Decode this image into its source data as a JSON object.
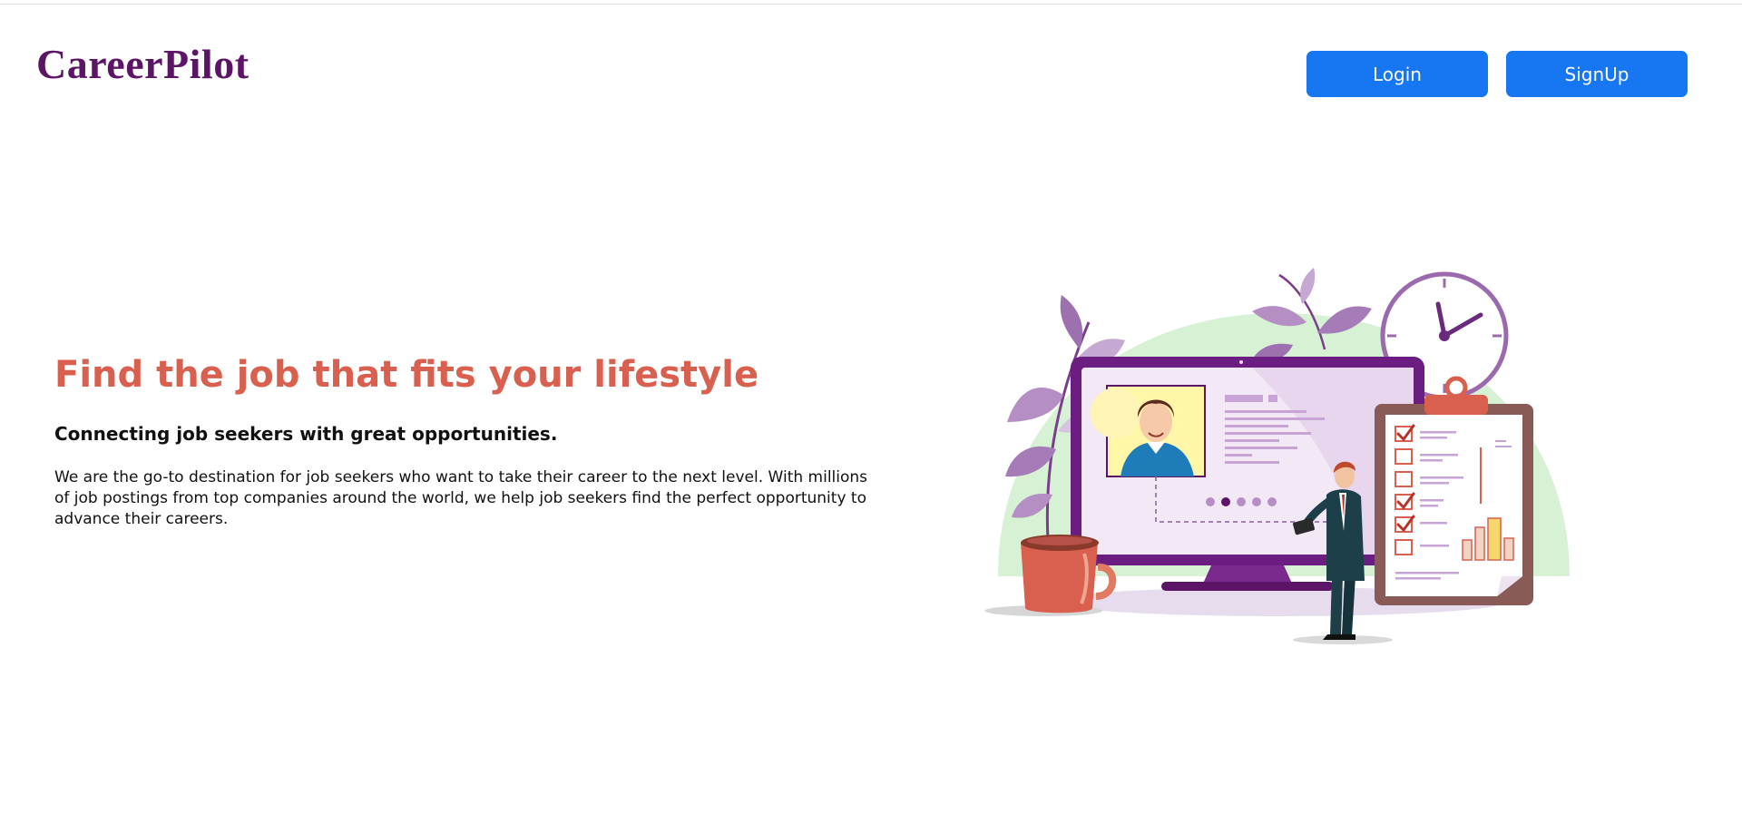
{
  "header": {
    "brand": "CareerPilot",
    "login_label": "Login",
    "signup_label": "SignUp"
  },
  "hero": {
    "title": "Find the job that fits your lifestyle",
    "subtitle": "Connecting job seekers with great opportunities.",
    "description": "We are the go-to destination for job seekers who want to take their career to the next level. With millions of job postings from top companies around the world, we help job seekers find the perfect opportunity to advance their careers."
  },
  "illustration": {
    "icon": "job-search-illustration",
    "carousel_dots": 5,
    "active_dot": 1,
    "checklist_items": 6,
    "checked_items": [
      0,
      3,
      4
    ]
  },
  "colors": {
    "brand": "#5c1466",
    "button": "#1776f2",
    "headline": "#d9604f",
    "purple_accent": "#7a2a8c",
    "green_bg": "#d7f1d4"
  }
}
